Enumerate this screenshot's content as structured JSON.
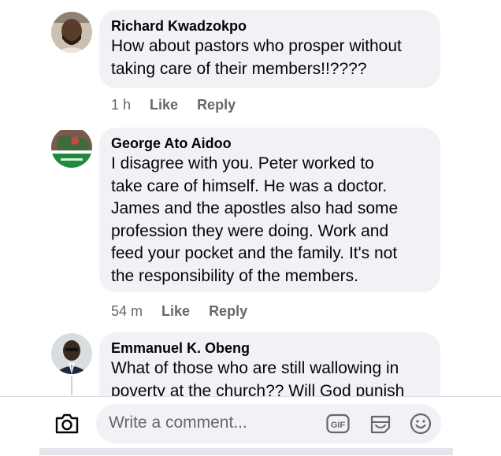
{
  "comments": [
    {
      "author": "Richard Kwadzokpo",
      "text": "How about pastors who prosper without\ntaking care of their members!!????",
      "time": "1 h",
      "like_label": "Like",
      "reply_label": "Reply"
    },
    {
      "author": "George Ato Aidoo",
      "text": "I disagree with you. Peter worked to\ntake care of himself. He was a doctor.\nJames and the apostles also had some\nprofession they were doing. Work and\nfeed your pocket and the family. It's not\nthe responsibility of the members.",
      "time": "54 m",
      "like_label": "Like",
      "reply_label": "Reply"
    },
    {
      "author": "Emmanuel K. Obeng",
      "text": "What of those who are still wallowing in\npoverty at the church?? Will God punish"
    }
  ],
  "composer": {
    "placeholder": "Write a comment...",
    "gif_label": "GIF"
  },
  "colors": {
    "bubble": "#f0f2f5",
    "secondary_text": "#65676b",
    "primary_text": "#050505"
  },
  "icons": [
    "camera-icon",
    "gif-icon",
    "sticker-icon",
    "emoji-icon"
  ]
}
